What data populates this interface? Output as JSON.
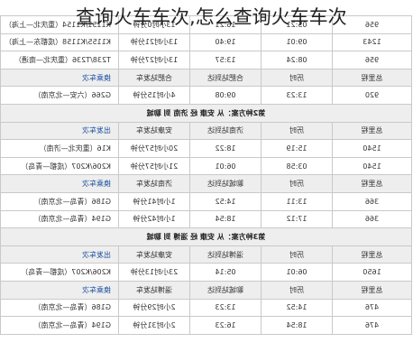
{
  "page_title": "查询火车车次,怎么查询火车车次",
  "table": {
    "row1": [
      "956",
      "05:21",
      "16:21",
      "13小时0分钟",
      "K1151/K1154（重庆北—上海）"
    ],
    "row2": [
      "1243",
      "09:01",
      "19:40",
      "13小时21分钟",
      "K1155/K1158（成都东—上海）"
    ],
    "row3": [
      "956",
      "08:24",
      "13:57",
      "13小时27分钟",
      "T238/T236（重庆北—南通）"
    ],
    "head1": [
      "总里程",
      "历时",
      "合肥站到达",
      "合肥站发车",
      "换乘车次"
    ],
    "row4": [
      "920",
      "13:23",
      "09:08",
      "4小时15分钟",
      "G266（六安—北京南）"
    ],
    "title2": "第2种方案：从 安康 经 济南 到 聊城",
    "head2": [
      "总里程",
      "历时",
      "济南站到达",
      "安康站发车",
      "出发车次"
    ],
    "row5": [
      "1540",
      "15:19",
      "18:22",
      "20小时57分钟",
      "K16（重庆北—济南）"
    ],
    "row6": [
      "1540",
      "03:58",
      "06:01",
      "21小时57分钟",
      "K206/K207（成都—青岛）"
    ],
    "head3": [
      "总里程",
      "历时",
      "聊城站到达",
      "济南站发车",
      "换乘车次"
    ],
    "row7": [
      "366",
      "13:11",
      "14:52",
      "1小时41分钟",
      "G186（青岛—北京南）"
    ],
    "row8": [
      "366",
      "17:12",
      "18:54",
      "1小时42分钟",
      "G194（青岛—北京南）"
    ],
    "title3": "第3种方案：从 安康 经 淄博 到 聊城",
    "head4": [
      "总里程",
      "历时",
      "淄博站到达",
      "安康站发车",
      "出发车次"
    ],
    "row9": [
      "1650",
      "06:01",
      "05:14",
      "23小时13分钟",
      "K206/K207（成都—青岛）"
    ],
    "head5": [
      "总里程",
      "历时",
      "聊城站到达",
      "淄博站发车",
      "换乘车次"
    ],
    "row10": [
      "476",
      "14:52",
      "13:23",
      "2小时29分钟",
      "G186（青岛—北京南）"
    ],
    "row11": [
      "476",
      "18:54",
      "16:23",
      "2小时31分钟",
      "G194（青岛—北京南）"
    ]
  }
}
